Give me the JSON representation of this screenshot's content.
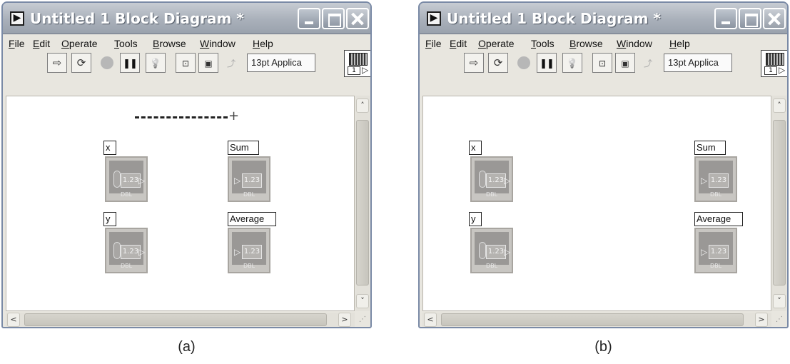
{
  "window": {
    "title": "Untitled 1 Block Diagram *",
    "app_icon": "▶"
  },
  "menu": [
    "File",
    "Edit",
    "Operate",
    "Tools",
    "Browse",
    "Window",
    "Help"
  ],
  "toolbar": {
    "run_icon": "⇨",
    "run_continuous_icon": "⟳",
    "pause_icon": "❚❚",
    "highlight_icon": "💡",
    "font_selector": "13pt Applica",
    "vi_icon_number": "1"
  },
  "scroll": {
    "up": "˄",
    "down": "˅",
    "left": "<",
    "right": ">",
    "grip": "⋰"
  },
  "terminal": {
    "value": "1.23",
    "type": "DBL",
    "out_arrow": "▷",
    "in_arrow": "▷"
  },
  "panels": {
    "a": {
      "caption": "(a)",
      "controls": [
        {
          "label": "x"
        },
        {
          "label": "y"
        }
      ],
      "indicators": [
        {
          "label": "Sum"
        },
        {
          "label": "Average"
        }
      ],
      "wiring_tool": "+"
    },
    "b": {
      "caption": "(b)",
      "controls": [
        {
          "label": "x"
        },
        {
          "label": "y"
        }
      ],
      "indicators": [
        {
          "label": "Sum"
        },
        {
          "label": "Average"
        }
      ]
    }
  },
  "colors": {
    "title_bar": "#a9b0ba",
    "terminal_fill": "#9a9896",
    "canvas": "#ffffff"
  }
}
